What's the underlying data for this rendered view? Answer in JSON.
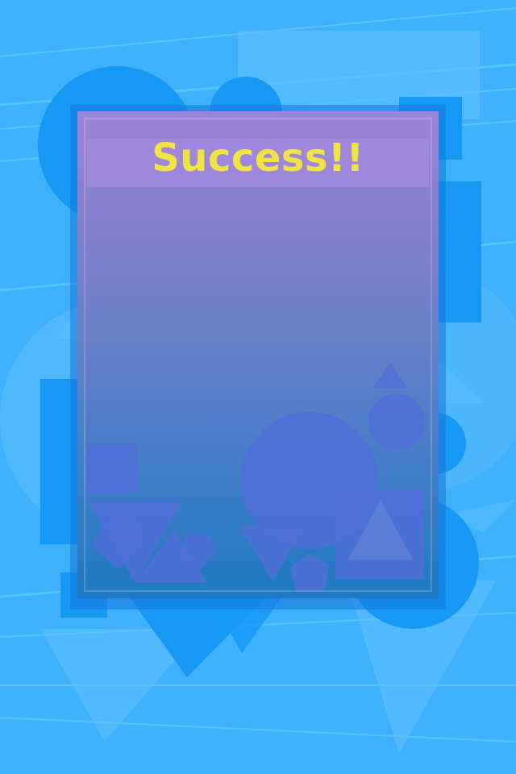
{
  "result_screen": {
    "title": "Success!!",
    "title_color": "#f0e443",
    "background_color": "#3fb0fb",
    "panel_color": "#6a80c8"
  }
}
